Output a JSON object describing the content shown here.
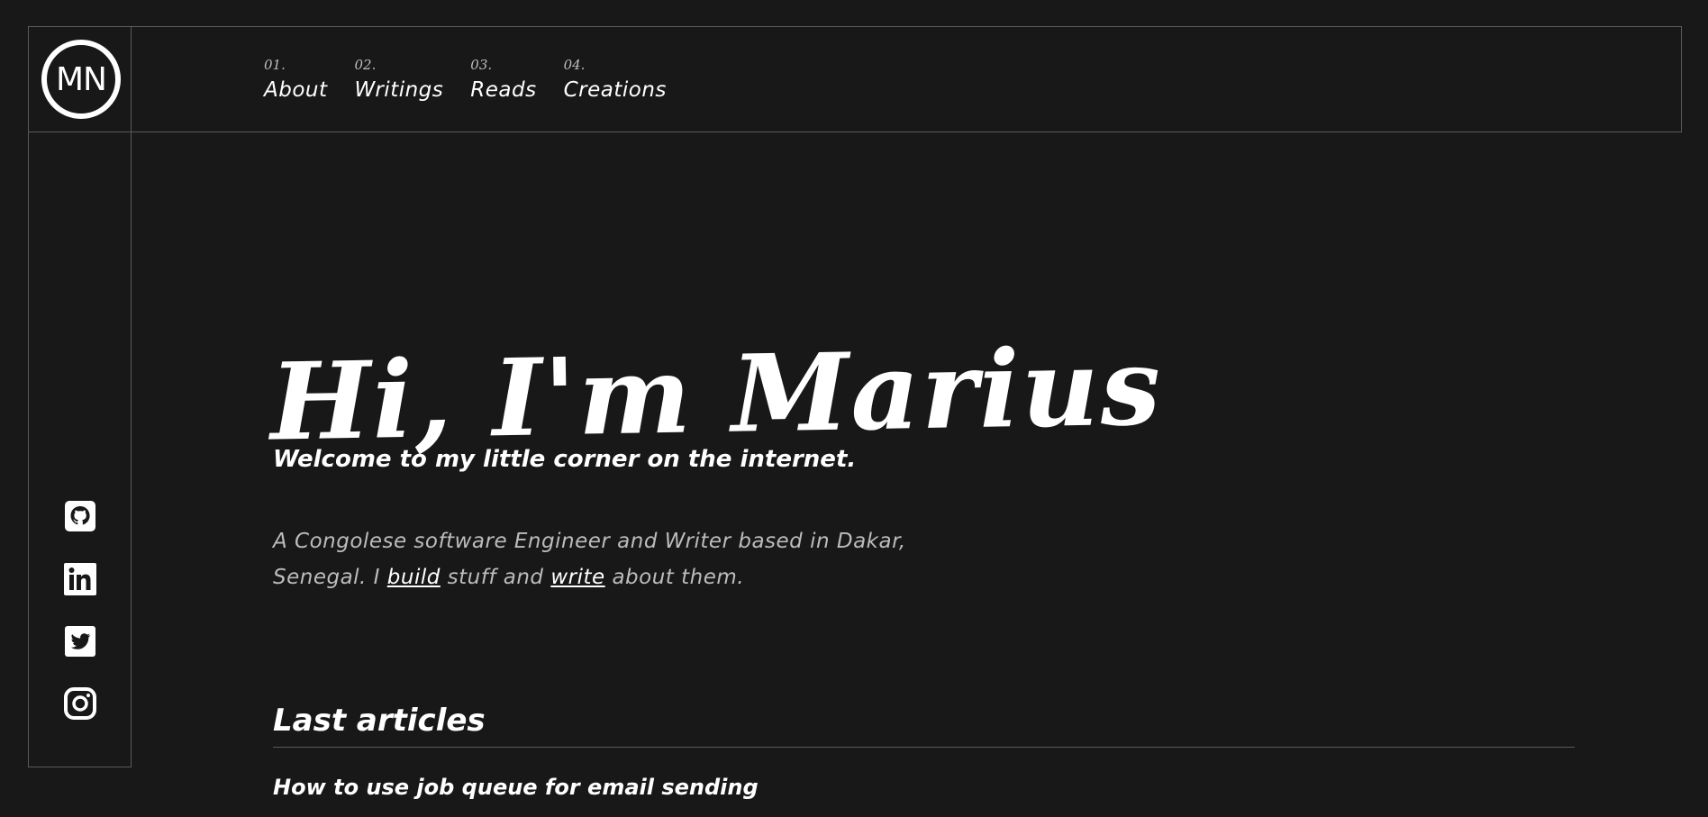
{
  "logo": {
    "text": "MN"
  },
  "nav": [
    {
      "num": "01.",
      "label": "About"
    },
    {
      "num": "02.",
      "label": "Writings"
    },
    {
      "num": "03.",
      "label": "Reads"
    },
    {
      "num": "04.",
      "label": "Creations"
    }
  ],
  "hero": {
    "title": "Hi, I'm Marius",
    "tagline": "Welcome to my little corner on the internet.",
    "bio_before": "A Congolese software Engineer and Writer based in Dakar, Senegal. I ",
    "link_build": "build",
    "bio_middle": " stuff and ",
    "link_write": "write",
    "bio_after": " about them."
  },
  "articles": {
    "section_title": "Last articles",
    "items": [
      {
        "title": "How to use job queue for email sending"
      }
    ]
  },
  "social": {
    "icons": [
      "github-icon",
      "linkedin-icon",
      "twitter-icon",
      "instagram-icon"
    ]
  },
  "colors": {
    "background": "#181818",
    "border": "#5a5a5a",
    "text": "#ffffff",
    "muted": "#bcbcbc"
  }
}
